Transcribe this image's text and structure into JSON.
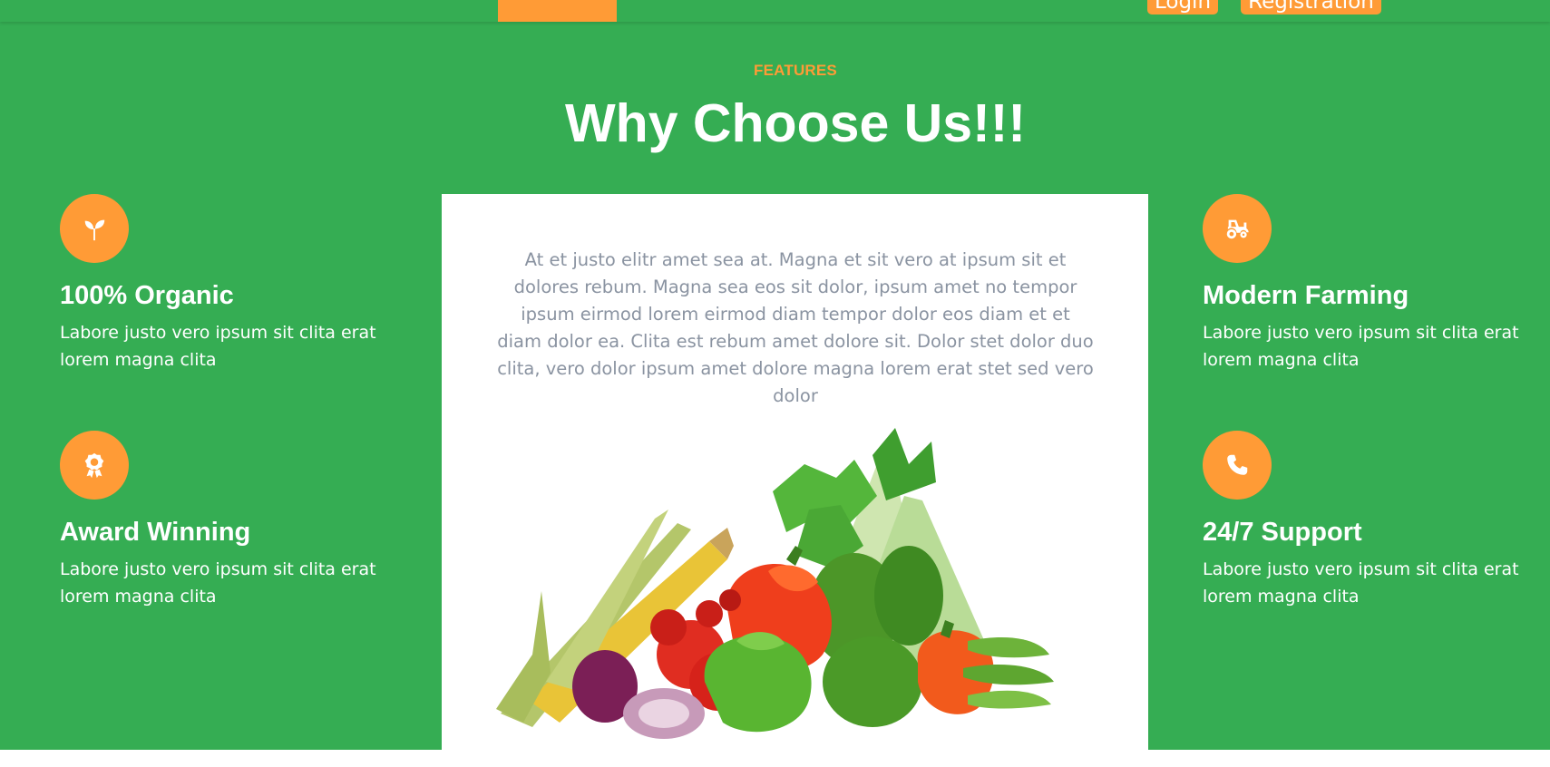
{
  "nav": {
    "login_label": "Login",
    "registration_label": "Registration"
  },
  "features": {
    "eyebrow": "FEATURES",
    "title": "Why Choose Us!!!",
    "items": [
      {
        "icon": "seedling-icon",
        "title": "100% Organic",
        "text": "Labore justo vero ipsum sit clita erat lorem magna clita"
      },
      {
        "icon": "award-icon",
        "title": "Award Winning",
        "text": "Labore justo vero ipsum sit clita erat lorem magna clita"
      },
      {
        "icon": "tractor-icon",
        "title": "Modern Farming",
        "text": "Labore justo vero ipsum sit clita erat lorem magna clita"
      },
      {
        "icon": "phone-icon",
        "title": "24/7 Support",
        "text": "Labore justo vero ipsum sit clita erat lorem magna clita"
      }
    ],
    "center_text": "At et justo elitr amet sea at. Magna et sit vero at ipsum sit et dolores rebum. Magna sea eos sit dolor, ipsum amet no tempor ipsum eirmod lorem eirmod diam tempor dolor eos diam et et diam dolor ea. Clita est rebum amet dolore sit. Dolor stet dolor duo clita, vero dolor ipsum amet dolore magna lorem erat stet sed vero dolor"
  },
  "colors": {
    "primary_green": "#35ad53",
    "accent_orange": "#ff9b36",
    "muted_text": "#8a93a1"
  }
}
